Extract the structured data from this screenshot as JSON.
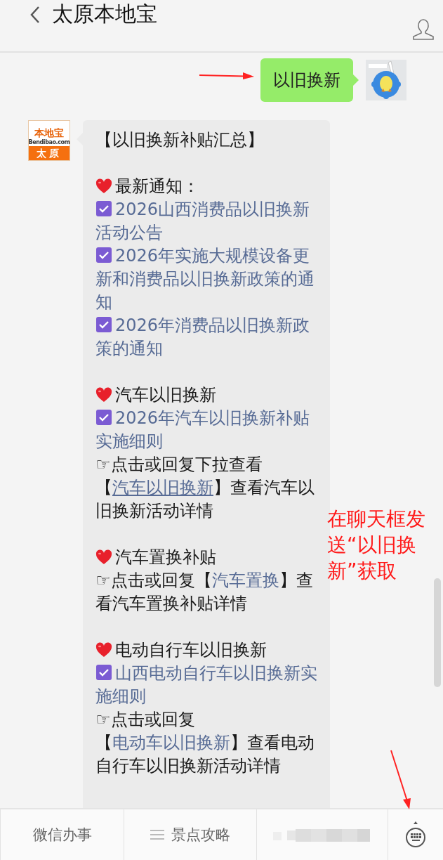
{
  "header": {
    "title": "太原本地宝"
  },
  "messages": [
    {
      "kind": "sent",
      "text": "以旧换新"
    },
    {
      "kind": "received",
      "avatar": {
        "brand": "本地宝",
        "domain": "Bendibao.com",
        "city": "太原"
      },
      "blocks": [
        [
          {
            "kind": "title",
            "text": "【以旧换新补贴汇总】"
          }
        ],
        [
          {
            "kind": "heading",
            "text": "最新通知："
          },
          {
            "kind": "link",
            "text": "2026山西消费品以旧换新活动公告"
          },
          {
            "kind": "link",
            "text": "2026年实施大规模设备更新和消费品以旧换新政策的通知"
          },
          {
            "kind": "link",
            "text": "2026年消费品以旧换新政策的通知"
          }
        ],
        [
          {
            "kind": "heading",
            "text": "汽车以旧换新"
          },
          {
            "kind": "link",
            "text": "2026年汽车以旧换新补贴实施细则"
          },
          {
            "kind": "note",
            "segments": [
              {
                "kind": "text",
                "text": "☞点击或回复下拉查看【"
              },
              {
                "kind": "link",
                "text": "汽车以旧换新",
                "underlined": true
              },
              {
                "kind": "text",
                "text": "】查看汽车以旧换新活动详情"
              }
            ]
          }
        ],
        [
          {
            "kind": "heading",
            "text": "汽车置换补贴"
          },
          {
            "kind": "note",
            "segments": [
              {
                "kind": "text",
                "text": "☞点击或回复【"
              },
              {
                "kind": "link",
                "text": "汽车置换",
                "underlined": false
              },
              {
                "kind": "text",
                "text": "】查看汽车置换补贴详情"
              }
            ]
          }
        ],
        [
          {
            "kind": "heading",
            "text": "电动自行车以旧换新"
          },
          {
            "kind": "link",
            "text": "山西电动自行车以旧换新实施细则"
          },
          {
            "kind": "note",
            "segments": [
              {
                "kind": "text",
                "text": "☞点击或回复【"
              },
              {
                "kind": "link",
                "text": "电动车以旧换新",
                "underlined": false
              },
              {
                "kind": "text",
                "text": "】查看电动自行车以旧换新活动详情"
              }
            ]
          }
        ]
      ]
    }
  ],
  "tabbar": {
    "items": [
      {
        "kind": "text",
        "label": "微信办事"
      },
      {
        "kind": "menu",
        "label": "景点攻略"
      },
      {
        "kind": "blurred"
      }
    ]
  },
  "annotation": {
    "text": "在聊天框发送“以旧换新”获取"
  }
}
